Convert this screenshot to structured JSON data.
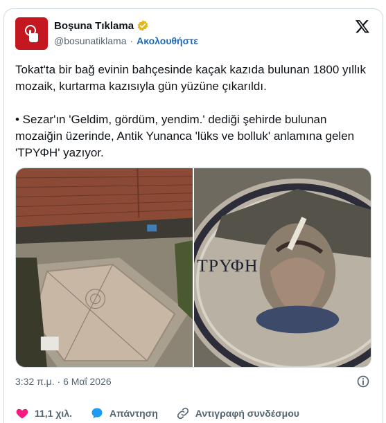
{
  "author": {
    "name": "Boşuna Tıklama",
    "handle": "@bosunatiklama",
    "separator": "·",
    "follow_label": "Ακολουθήστε"
  },
  "tweet": {
    "text": "Tokat'ta bir bağ evinin bahçesinde kaçak kazıda bulunan 1800 yıllık mozaik, kurtarma kazısıyla gün yüzüne çıkarıldı.\n\n• Sezar'ın 'Geldim, gördüm, yendim.' dediği şehirde bulunan mozaiğin üzerinde, Antik Yunanca 'lüks ve bolluk' anlamına gelen 'TΡΥΦΗ' yazıyor.",
    "timestamp": "3:32 π.μ. · 6 Μαΐ 2026"
  },
  "media": {
    "right_image_inscription": "ΤΡΥΦΗ"
  },
  "actions": {
    "likes": "11,1 χιλ.",
    "reply_label": "Απάντηση",
    "copy_link_label": "Αντιγραφή συνδέσμου"
  },
  "icons": {
    "avatar": "tap-hand-icon",
    "verified": "gold-verified-badge-icon",
    "platform": "x-logo-icon",
    "info": "info-icon",
    "like": "heart-icon",
    "reply": "speech-bubble-icon",
    "copy_link": "link-icon"
  },
  "colors": {
    "avatar_bg": "#c4171f",
    "follow": "#1d6bb8",
    "heart": "#f91880",
    "reply": "#1d9bf0",
    "verified": "#e2b719"
  }
}
